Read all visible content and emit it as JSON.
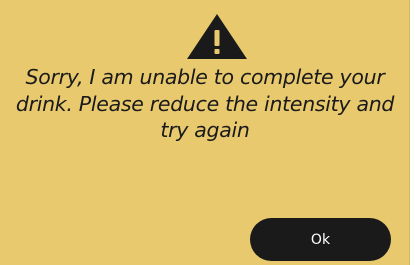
{
  "dialog": {
    "icon": "warning-triangle-icon",
    "message": "Sorry, I am unable to complete your drink. Please reduce the intensity and try again",
    "ok_label": "Ok"
  },
  "colors": {
    "background": "#e8c96e",
    "text": "#1a1a1a",
    "button_background": "#1a1a1a",
    "button_text": "#ffffff"
  }
}
